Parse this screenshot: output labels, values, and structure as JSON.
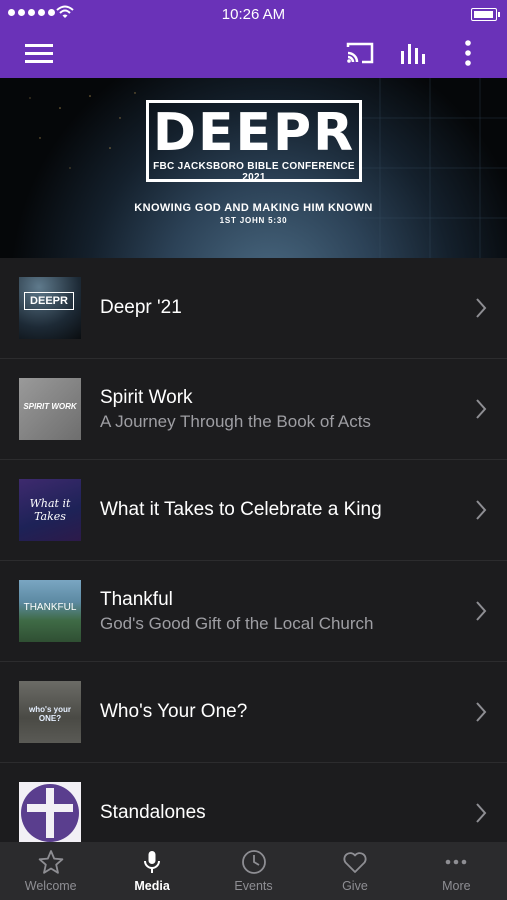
{
  "status_bar": {
    "time": "10:26 AM"
  },
  "app_bar": {
    "menu_icon": "hamburger-menu-icon",
    "actions": [
      "cast-icon",
      "audio-bars-icon",
      "more-vertical-icon"
    ]
  },
  "hero": {
    "title": "DEEPR",
    "conference": "FBC JACKSBORO BIBLE CONFERENCE 2021",
    "tagline": "KNOWING GOD AND MAKING HIM KNOWN",
    "reference": "1ST JOHN 5:30"
  },
  "series": [
    {
      "title": "Deepr '21",
      "subtitle": "",
      "thumb_text": "DEEPR"
    },
    {
      "title": "Spirit Work",
      "subtitle": "A Journey Through the Book of Acts",
      "thumb_text": "SPIRIT WORK"
    },
    {
      "title": "What it Takes to Celebrate a King",
      "subtitle": "",
      "thumb_text": "What it Takes"
    },
    {
      "title": "Thankful",
      "subtitle": "God's Good Gift of the Local Church",
      "thumb_text": "THANKFUL"
    },
    {
      "title": "Who's Your One?",
      "subtitle": "",
      "thumb_text": "who's your ONE?"
    },
    {
      "title": "Standalones",
      "subtitle": "",
      "thumb_text": ""
    }
  ],
  "tabs": [
    {
      "label": "Welcome",
      "icon": "star-icon",
      "active": false
    },
    {
      "label": "Media",
      "icon": "microphone-icon",
      "active": true
    },
    {
      "label": "Events",
      "icon": "clock-icon",
      "active": false
    },
    {
      "label": "Give",
      "icon": "heart-icon",
      "active": false
    },
    {
      "label": "More",
      "icon": "more-horizontal-icon",
      "active": false
    }
  ],
  "colors": {
    "app_bar": "#6a32b8",
    "background": "#1c1c1e",
    "tab_bar": "#2b2b2d",
    "subtitle": "#9e9ea3"
  }
}
